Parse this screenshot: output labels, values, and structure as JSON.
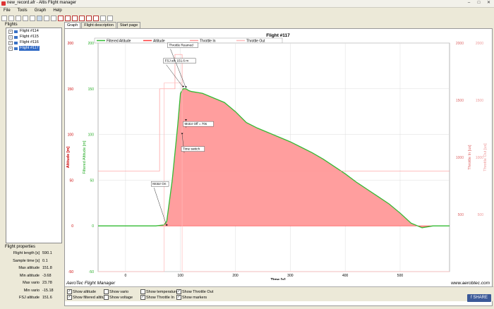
{
  "window": {
    "title": "new_record.afr - Altis Flight manager",
    "minimize": "–",
    "maximize": "□",
    "close": "✕"
  },
  "menu": [
    "File",
    "Tools",
    "Graph",
    "Help"
  ],
  "toolbar_icons": [
    "new-file-icon",
    "open-folder-icon",
    "save-icon",
    "print-icon",
    "copy-icon",
    "zoom-in-icon",
    "zoom-out-icon",
    "zoom-fit-icon",
    "delete-flight-icon",
    "delete-icon",
    "delete-all-icon",
    "cut-icon",
    "export-icon",
    "settings-icon",
    "hide-icon",
    "eye-icon"
  ],
  "flights_panel": {
    "label": "Flights",
    "items": [
      {
        "label": "Flight #114",
        "selected": false
      },
      {
        "label": "Flight #115",
        "selected": false
      },
      {
        "label": "Flight #116",
        "selected": false
      },
      {
        "label": "Flight #117",
        "selected": true
      }
    ]
  },
  "properties": {
    "label": "Flight properties",
    "rows": [
      {
        "k": "Flight length [s]",
        "v": "590.1"
      },
      {
        "k": "Sample time [s]",
        "v": "0.1"
      },
      {
        "k": "Max altitude",
        "v": "151.8"
      },
      {
        "k": "Min altitude",
        "v": "-3.68"
      },
      {
        "k": "Max vario",
        "v": "23.78"
      },
      {
        "k": "Min vario",
        "v": "-15.18"
      },
      {
        "k": "FSJ altitude",
        "v": "151.6"
      }
    ]
  },
  "tabs": [
    {
      "label": "Graph",
      "active": true
    },
    {
      "label": "Flight description",
      "active": false
    },
    {
      "label": "Start page",
      "active": false
    }
  ],
  "footer": {
    "brand": "AeroTec Flight Manager",
    "website": "www.aerobtec.com"
  },
  "checkboxes": [
    {
      "label": "Show altitude",
      "checked": true
    },
    {
      "label": "Show filtered altitude",
      "checked": true
    },
    {
      "label": "Show vario",
      "checked": false
    },
    {
      "label": "Show voltage",
      "checked": false
    },
    {
      "label": "Show temperature",
      "checked": false
    },
    {
      "label": "Show Throttle In",
      "checked": true
    },
    {
      "label": "Show Throttle Out",
      "checked": true
    },
    {
      "label": "Show markers",
      "checked": true
    }
  ],
  "share_button": "SHARE",
  "colors": {
    "altitude": "#ff3a3a",
    "filtered": "#33bb33",
    "throttle_in": "#ff9999",
    "throttle_out": "#ffbbbb",
    "area": "#ff9e9e"
  },
  "chart_data": {
    "type": "area",
    "title": "Flight #117",
    "xlabel": "Time [s]",
    "ylabel_left": "Altitude [m]",
    "ylabel_left_inner": "Filtered Altitude [m]",
    "ylabel_right_inner": "Throttle In [us]",
    "ylabel_right_outer": "Throttle Out [us]",
    "xlim": [
      -50,
      590
    ],
    "ylim": [
      -50,
      200
    ],
    "ylim_right": [
      0,
      2000
    ],
    "xticks": [
      0,
      100,
      200,
      300,
      400,
      500
    ],
    "yticks": [
      -50,
      0,
      50,
      100,
      150,
      200
    ],
    "yticks_right": [
      500,
      1000,
      1500,
      2000
    ],
    "grid": true,
    "legend": {
      "placement": "top",
      "entries": [
        "Filtered Altitude",
        "Altitude",
        "Throttle In",
        "Throttle Out"
      ]
    },
    "series": [
      {
        "name": "Altitude",
        "x": [
          -50,
          55,
          70,
          75,
          85,
          95,
          100,
          105,
          110,
          115,
          120,
          140,
          160,
          180,
          200,
          220,
          240,
          260,
          280,
          300,
          320,
          340,
          360,
          380,
          400,
          420,
          440,
          460,
          480,
          500,
          520,
          540,
          560,
          590
        ],
        "values": [
          0,
          0,
          1,
          5,
          50,
          110,
          145,
          150,
          150,
          148,
          147,
          145,
          140,
          135,
          125,
          113,
          107,
          102,
          97,
          92,
          86,
          80,
          73,
          65,
          57,
          48,
          40,
          32,
          24,
          14,
          3,
          -2,
          0,
          0
        ]
      },
      {
        "name": "Filtered Altitude",
        "x": [
          -50,
          55,
          70,
          75,
          85,
          95,
          100,
          105,
          110,
          115,
          120,
          140,
          160,
          180,
          200,
          220,
          240,
          260,
          280,
          300,
          320,
          340,
          360,
          380,
          400,
          420,
          440,
          460,
          480,
          500,
          520,
          540,
          560,
          590
        ],
        "values": [
          0,
          0,
          1,
          5,
          50,
          110,
          145,
          150,
          150,
          148,
          147,
          145,
          140,
          135,
          125,
          113,
          107,
          102,
          97,
          92,
          86,
          80,
          73,
          65,
          57,
          48,
          40,
          32,
          24,
          14,
          3,
          -2,
          0,
          0
        ]
      },
      {
        "name": "Throttle In",
        "x": [
          -50,
          62,
          62,
          90,
          90,
          103,
          103,
          590
        ],
        "values": [
          880,
          880,
          1600,
          1600,
          1900,
          1900,
          880,
          880
        ]
      },
      {
        "name": "Throttle Out",
        "x": [
          -50,
          70,
          70,
          103,
          103,
          590
        ],
        "values": [
          0,
          0,
          1650,
          1650,
          0,
          0
        ]
      }
    ],
    "annotations": [
      {
        "label": "Motor On",
        "x": 75,
        "y": 0
      },
      {
        "label": "FSJ alt: 151.6 m",
        "x": 105,
        "y": 151.6
      },
      {
        "label": "Throttle Reamed",
        "x": 110,
        "y": 151
      },
      {
        "label": "Motor Off = 70s",
        "x": 110,
        "y": 115
      },
      {
        "label": "Time switch",
        "x": 103,
        "y": 100
      }
    ]
  }
}
